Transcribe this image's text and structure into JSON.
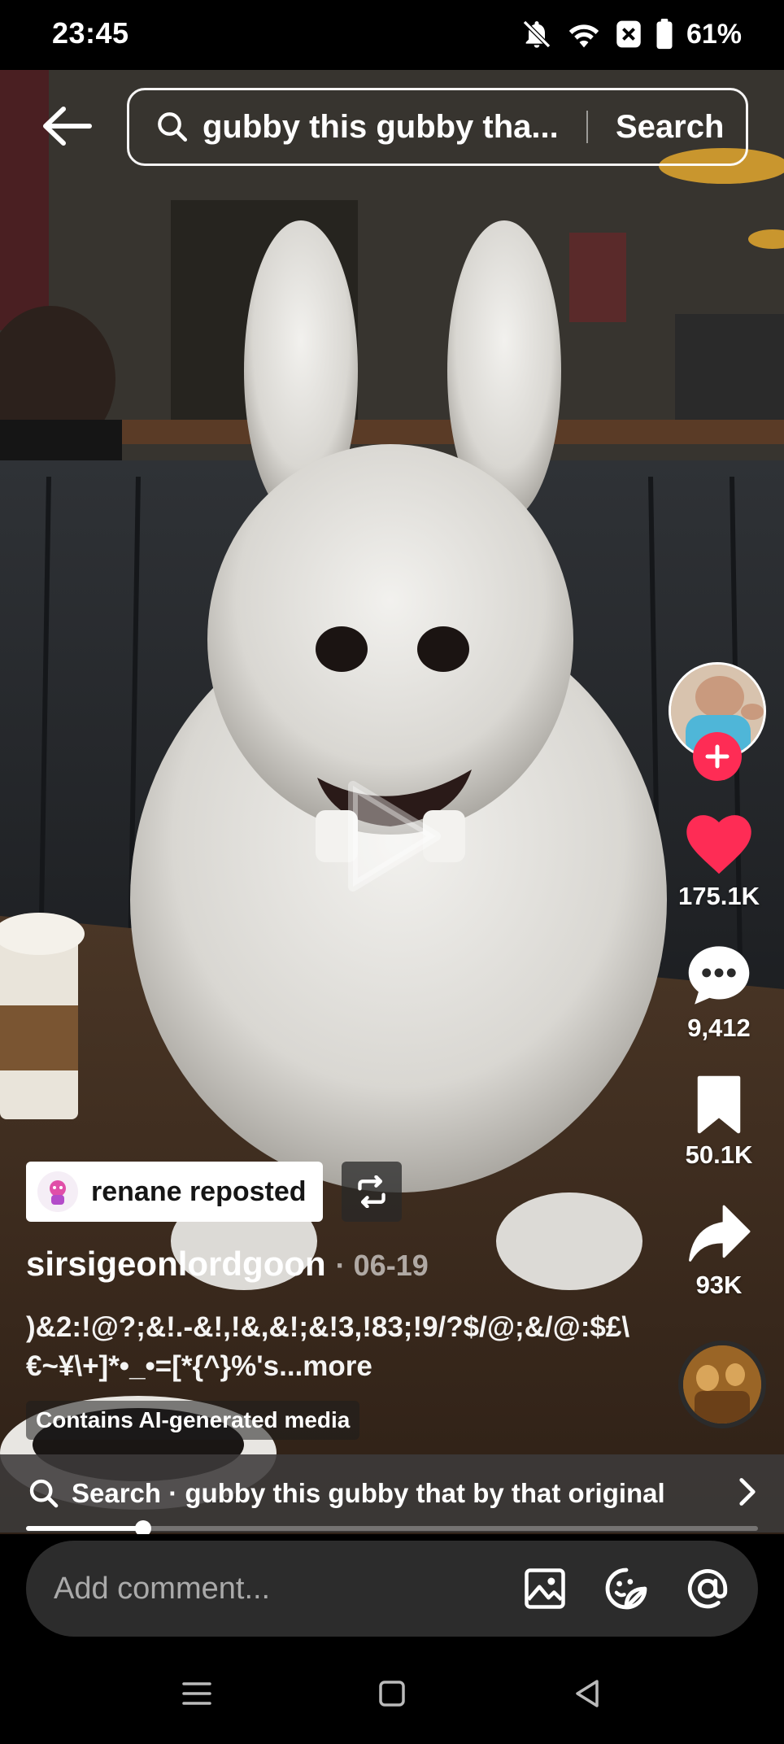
{
  "status_bar": {
    "time": "23:45",
    "battery_percent": "61%",
    "icons": [
      "bell-off-icon",
      "wifi-icon",
      "x-box-icon",
      "battery-icon"
    ]
  },
  "search": {
    "query": "gubby this gubby tha...",
    "button_label": "Search"
  },
  "rail": {
    "likes": "175.1K",
    "comments": "9,412",
    "saves": "50.1K",
    "shares": "93K",
    "follow_symbol": "+"
  },
  "post": {
    "repost_label": "renane reposted",
    "author": "sirsigeonlordgoon",
    "date": "· 06-19",
    "caption": ")&2:!@?;&!.-&!,!&,&!;&!3,!83;!9/?$/@;&/@:$£\\€~¥\\+]*•_•=[*{^}%'s",
    "caption_more": "...more",
    "ai_badge": "Contains AI-generated media"
  },
  "search_suggest": {
    "text": "Search · gubby this gubby that by that original"
  },
  "progress": {
    "fraction": 0.16
  },
  "comment": {
    "placeholder": "Add comment..."
  },
  "colors": {
    "like_red": "#fe2c55",
    "follow_red": "#fe2c55"
  }
}
